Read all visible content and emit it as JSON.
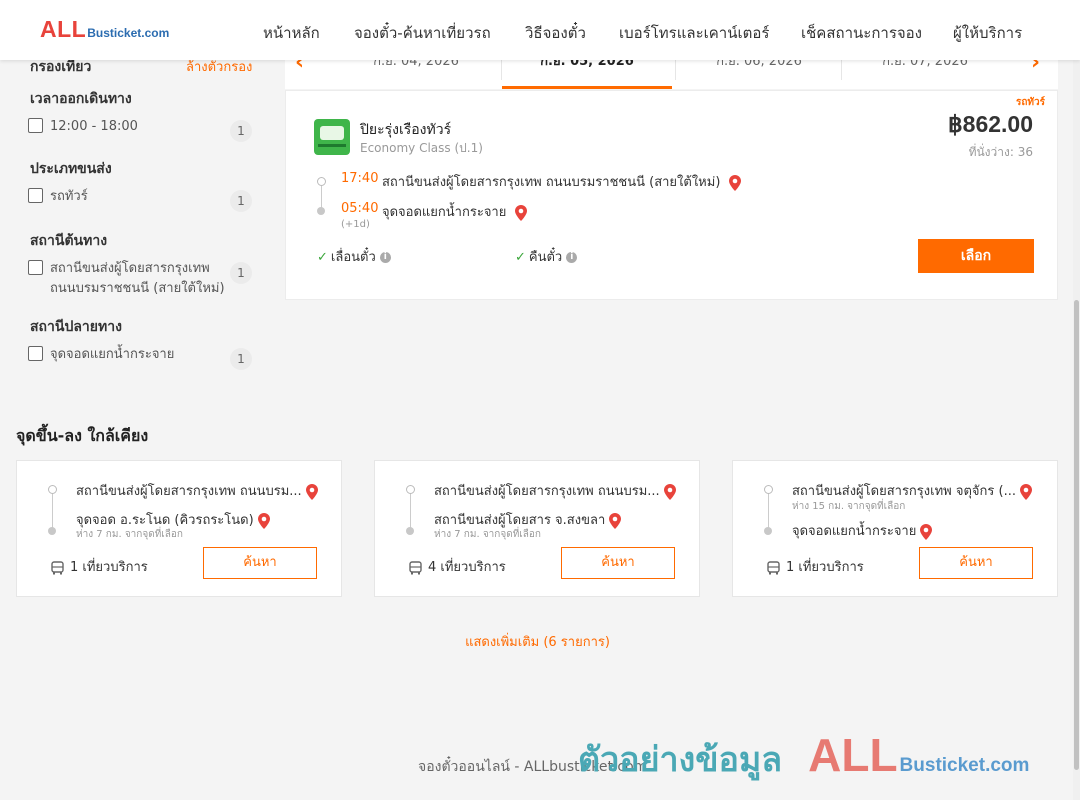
{
  "header": {
    "logo_all": "ALL",
    "logo_rest": "Busticket.com",
    "nav": [
      "หน้าหลัก",
      "จองตั๋ว-ค้นหาเที่ยวรถ",
      "วิธีจองตั๋ว",
      "เบอร์โทรและเคาน์เตอร์",
      "เช็คสถานะการจอง",
      "ผู้ให้บริการ"
    ]
  },
  "sidebar": {
    "heading": "กรองเที่ยว",
    "clear": "ล้างตัวกรอง",
    "groups": [
      {
        "title": "เวลาออกเดินทาง",
        "option": "12:00 - 18:00",
        "count": "1"
      },
      {
        "title": "ประเภทขนส่ง",
        "option": "รถทัวร์",
        "count": "1"
      },
      {
        "title": "สถานีต้นทาง",
        "option_line1": "สถานีขนส่งผู้โดยสารกรุงเทพ",
        "option_line2": "ถนนบรมราชชนนี (สายใต้ใหม่)",
        "count": "1"
      },
      {
        "title": "สถานีปลายทาง",
        "option": "จุดจอดแยกน้ำกระจาย",
        "count": "1"
      }
    ]
  },
  "dates": [
    "ก.ย. 04, 2026",
    "ก.ย. 05, 2026",
    "ก.ย. 06, 2026",
    "ก.ย. 07, 2026"
  ],
  "trip": {
    "vehicle_tag": "รถทัวร์",
    "operator": "ปิยะรุ่งเรืองทัวร์",
    "class": "Economy Class (ป.1)",
    "price": "฿862.00",
    "seats": "ที่นั่งว่าง: 36",
    "depart_time": "17:40",
    "depart_stop": "สถานีขนส่งผู้โดยสารกรุงเทพ ถนนบรมราชชนนี (สายใต้ใหม่)",
    "arrive_time": "05:40",
    "arrive_stop": "จุดจอดแยกน้ำกระจาย",
    "plus_day": "(+1d)",
    "feature1": "เลื่อนตั๋ว",
    "feature2": "คืนตั๋ว",
    "select": "เลือก"
  },
  "nearby": {
    "title": "จุดขึ้น-ลง ใกล้เคียง",
    "cards": [
      {
        "from": "สถานีขนส่งผู้โดยสารกรุงเทพ ถนนบรม...",
        "to": "จุดจอด อ.ระโนด (คิวรถระโนด)",
        "dist": "ห่าง 7 กม. จากจุดที่เลือก",
        "trips": "1 เที่ยวบริการ",
        "button": "ค้นหา"
      },
      {
        "from": "สถานีขนส่งผู้โดยสารกรุงเทพ ถนนบรม...",
        "to": "สถานีขนส่งผู้โดยสาร จ.สงขลา",
        "dist": "ห่าง 7 กม. จากจุดที่เลือก",
        "trips": "4 เที่ยวบริการ",
        "button": "ค้นหา"
      },
      {
        "from": "สถานีขนส่งผู้โดยสารกรุงเทพ จตุจักร (...",
        "dist": "ห่าง 15 กม. จากจุดที่เลือก",
        "to": "จุดจอดแยกน้ำกระจาย",
        "trips": "1 เที่ยวบริการ",
        "button": "ค้นหา"
      }
    ],
    "more": "แสดงเพิ่มเติม (6 รายการ)"
  },
  "footer": "จองตั๋วออนไลน์ - ALLbusticket.com",
  "watermark": {
    "text": "ตัวอย่างข้อมูล",
    "all": "ALL",
    "rest": "Busticket.com"
  },
  "colors": {
    "accent": "#ff6a00",
    "logo_red": "#e8433b",
    "logo_blue": "#2b6cb0",
    "success": "#3aa63a"
  }
}
